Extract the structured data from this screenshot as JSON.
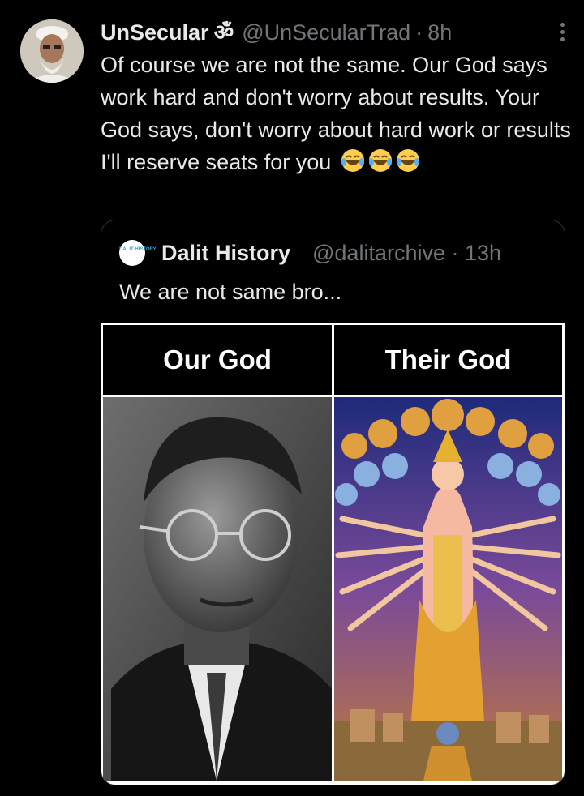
{
  "tweet": {
    "author_name": "UnSecular",
    "name_symbol": "ॐ",
    "handle": "@UnSecularTrad",
    "separator": "·",
    "time": "8h",
    "text": "Of course we are not the same. Our God says work hard and don't worry about results. Your God says, don't worry about hard work or results I'll reserve seats for you",
    "emoji": [
      "face-with-tears-of-joy",
      "face-with-tears-of-joy",
      "face-with-tears-of-joy"
    ]
  },
  "quote": {
    "logo_text": "DALIT HISTORY",
    "author_name": "Dalit History",
    "handle": "@dalitarchive",
    "separator": "·",
    "time": "13h",
    "text": "We are not same bro...",
    "meme": {
      "left_label": "Our God",
      "right_label": "Their God"
    }
  },
  "colors": {
    "background": "#000000",
    "text": "#e7e9ea",
    "muted": "#71767b",
    "border": "#2f3336"
  }
}
